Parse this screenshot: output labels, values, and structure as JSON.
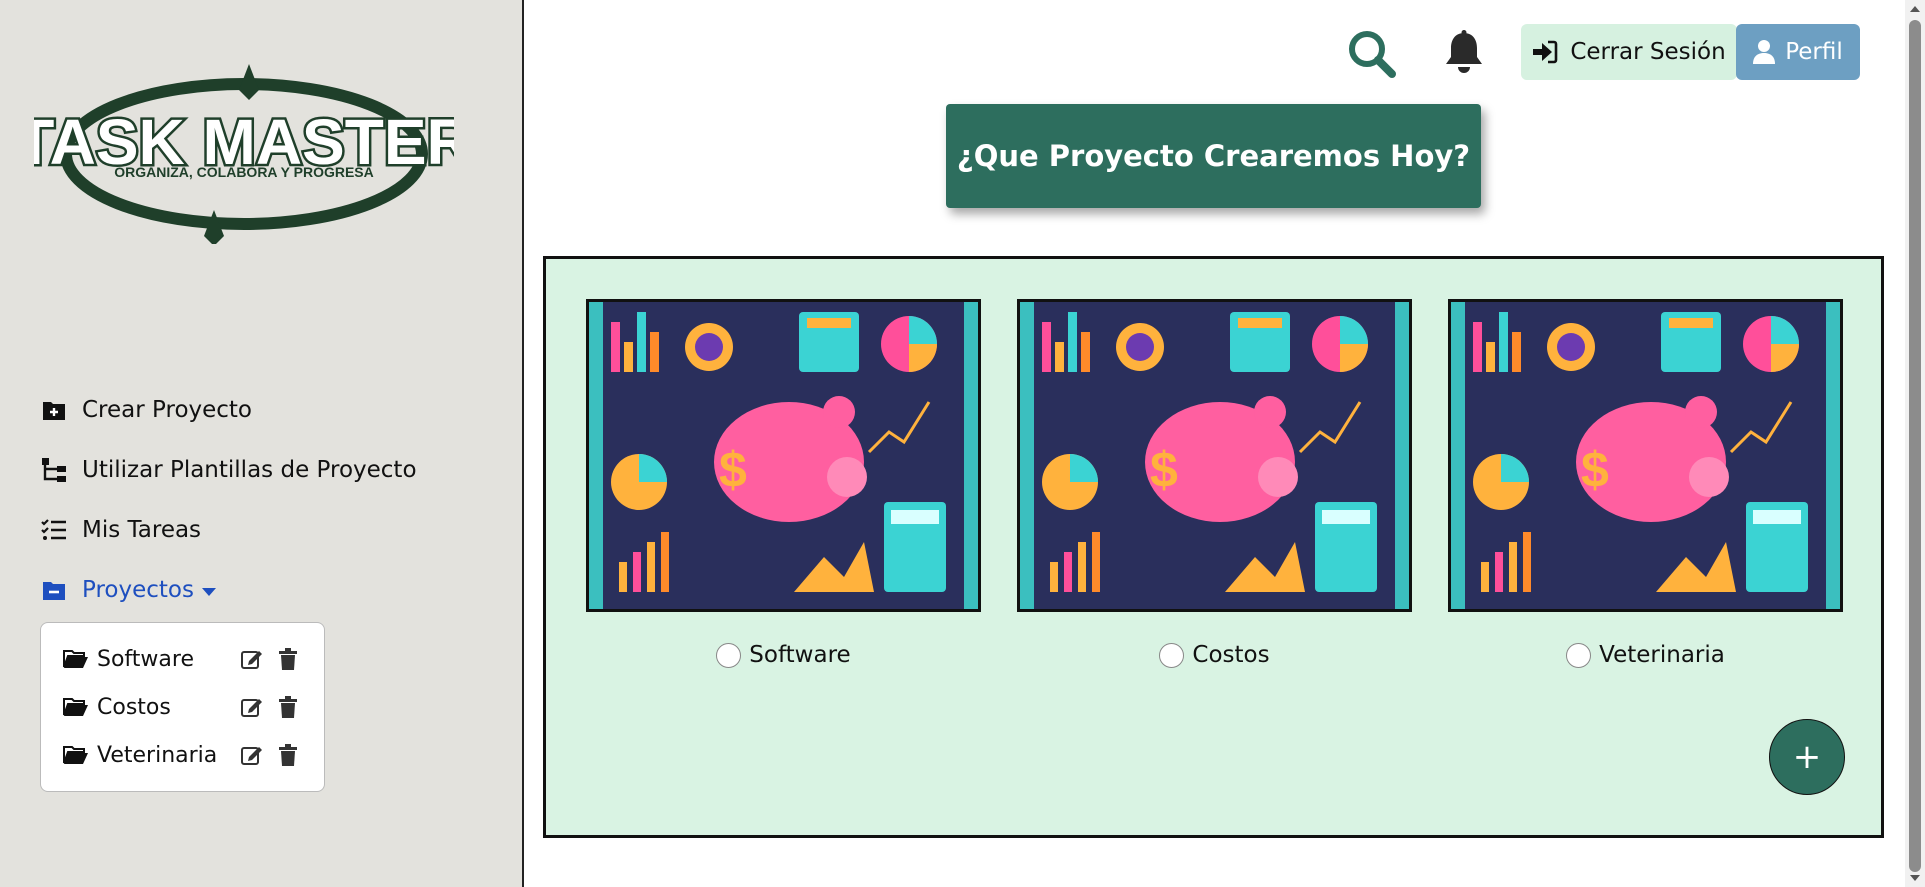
{
  "brand": {
    "title": "TASK MASTER",
    "tagline": "ORGANIZA, COLABORA Y PROGRESA"
  },
  "sidebar": {
    "nav": [
      {
        "label": "Crear Proyecto",
        "icon": "folder-plus-icon"
      },
      {
        "label": "Utilizar Plantillas de Proyecto",
        "icon": "sitemap-icon"
      },
      {
        "label": "Mis Tareas",
        "icon": "list-check-icon"
      },
      {
        "label": "Proyectos",
        "icon": "folder-minus-icon"
      }
    ],
    "projects": [
      {
        "label": "Software"
      },
      {
        "label": "Costos"
      },
      {
        "label": "Veterinaria"
      }
    ]
  },
  "header": {
    "logout_label": "Cerrar Sesión",
    "profile_label": "Perfil"
  },
  "hero": {
    "title": "¿Que Proyecto Crearemos Hoy?"
  },
  "cards": [
    {
      "label": "Software"
    },
    {
      "label": "Costos"
    },
    {
      "label": "Veterinaria"
    }
  ],
  "fab_label": "+",
  "colors": {
    "accent": "#2d6e5e",
    "panel_bg": "#d9f3e3",
    "sidebar_bg": "#e3e2dd",
    "active_nav": "#1e4fbf",
    "profile_btn": "#6d9fc2",
    "logout_btn": "#d6f1e0"
  }
}
